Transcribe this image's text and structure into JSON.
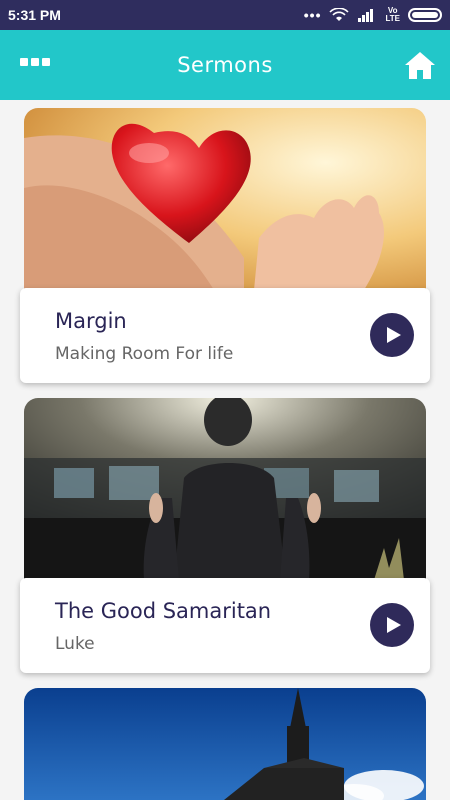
{
  "status_bar": {
    "time": "5:31 PM",
    "dots": "•••",
    "volte": "Vo\nLTE"
  },
  "header": {
    "title": "Sermons",
    "menu_icon": "menu-dots-icon",
    "home_icon": "home-icon"
  },
  "colors": {
    "status_bar": "#2f2d5e",
    "header": "#22c7c9",
    "play_button": "#2f2a5a",
    "title_text": "#2a2556",
    "subtitle_text": "#666666"
  },
  "sermons": [
    {
      "title": "Margin",
      "subtitle": "Making Room For life",
      "image": "hands-holding-red-heart"
    },
    {
      "title": "The Good Samaritan",
      "subtitle": "Luke",
      "image": "man-praying-raised-hands"
    },
    {
      "title": "",
      "subtitle": "",
      "image": "church-steeple-blue-sky"
    }
  ]
}
